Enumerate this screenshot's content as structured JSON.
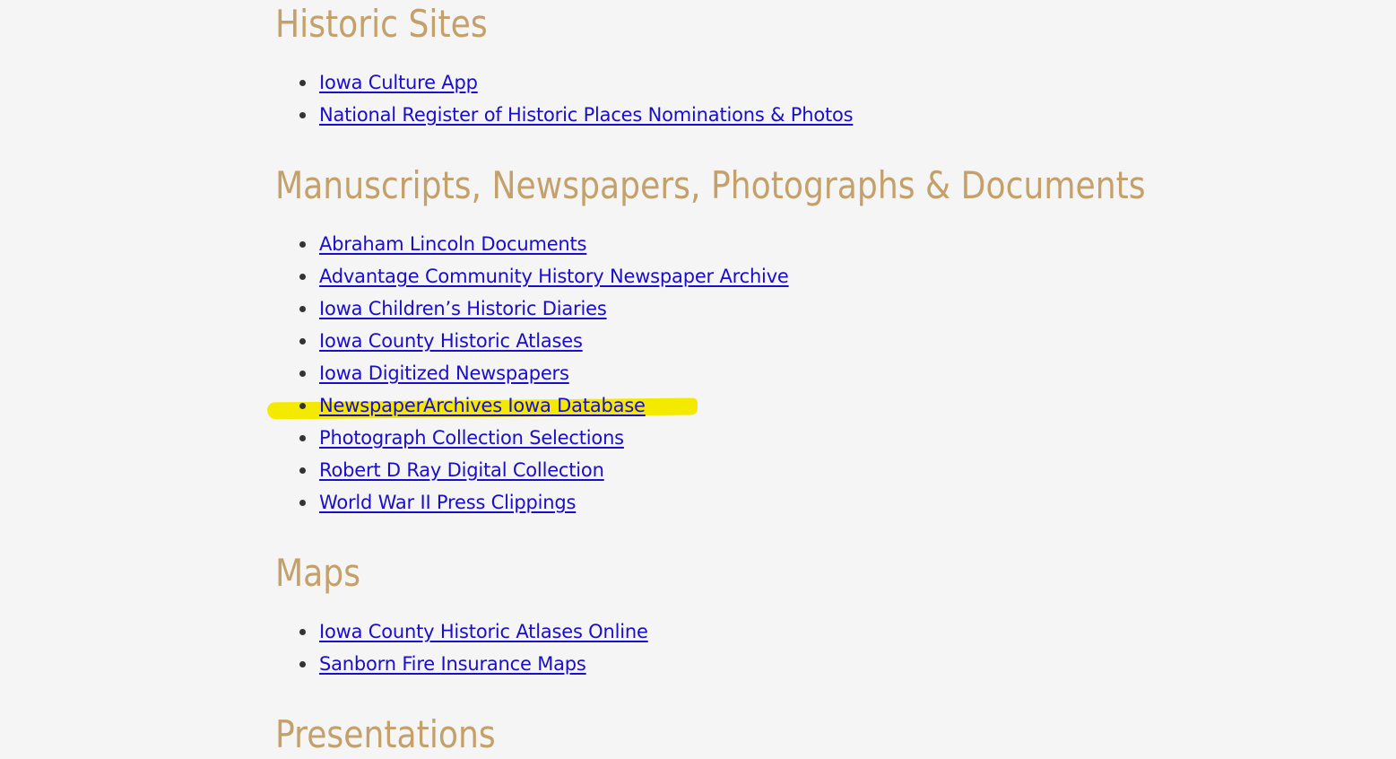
{
  "sections": [
    {
      "heading": "Historic Sites",
      "links": [
        "Iowa Culture App",
        "National Register of Historic Places Nominations & Photos"
      ]
    },
    {
      "heading": "Manuscripts, Newspapers, Photographs & Documents",
      "links": [
        "Abraham Lincoln Documents",
        "Advantage Community History Newspaper Archive",
        "Iowa Children’s Historic Diaries",
        "Iowa County Historic Atlases",
        "Iowa Digitized Newspapers",
        "NewspaperArchives Iowa Database",
        "Photograph Collection Selections",
        "Robert D Ray Digital Collection",
        "World War II Press Clippings"
      ]
    },
    {
      "heading": "Maps",
      "links": [
        "Iowa County Historic Atlases Online",
        "Sanborn Fire Insurance Maps"
      ]
    },
    {
      "heading": "Presentations",
      "links": []
    }
  ],
  "colors": {
    "heading": "#c4a06a",
    "link": "#1a0dcc",
    "background": "#f5f5f5",
    "highlight": "#f4ea00"
  }
}
